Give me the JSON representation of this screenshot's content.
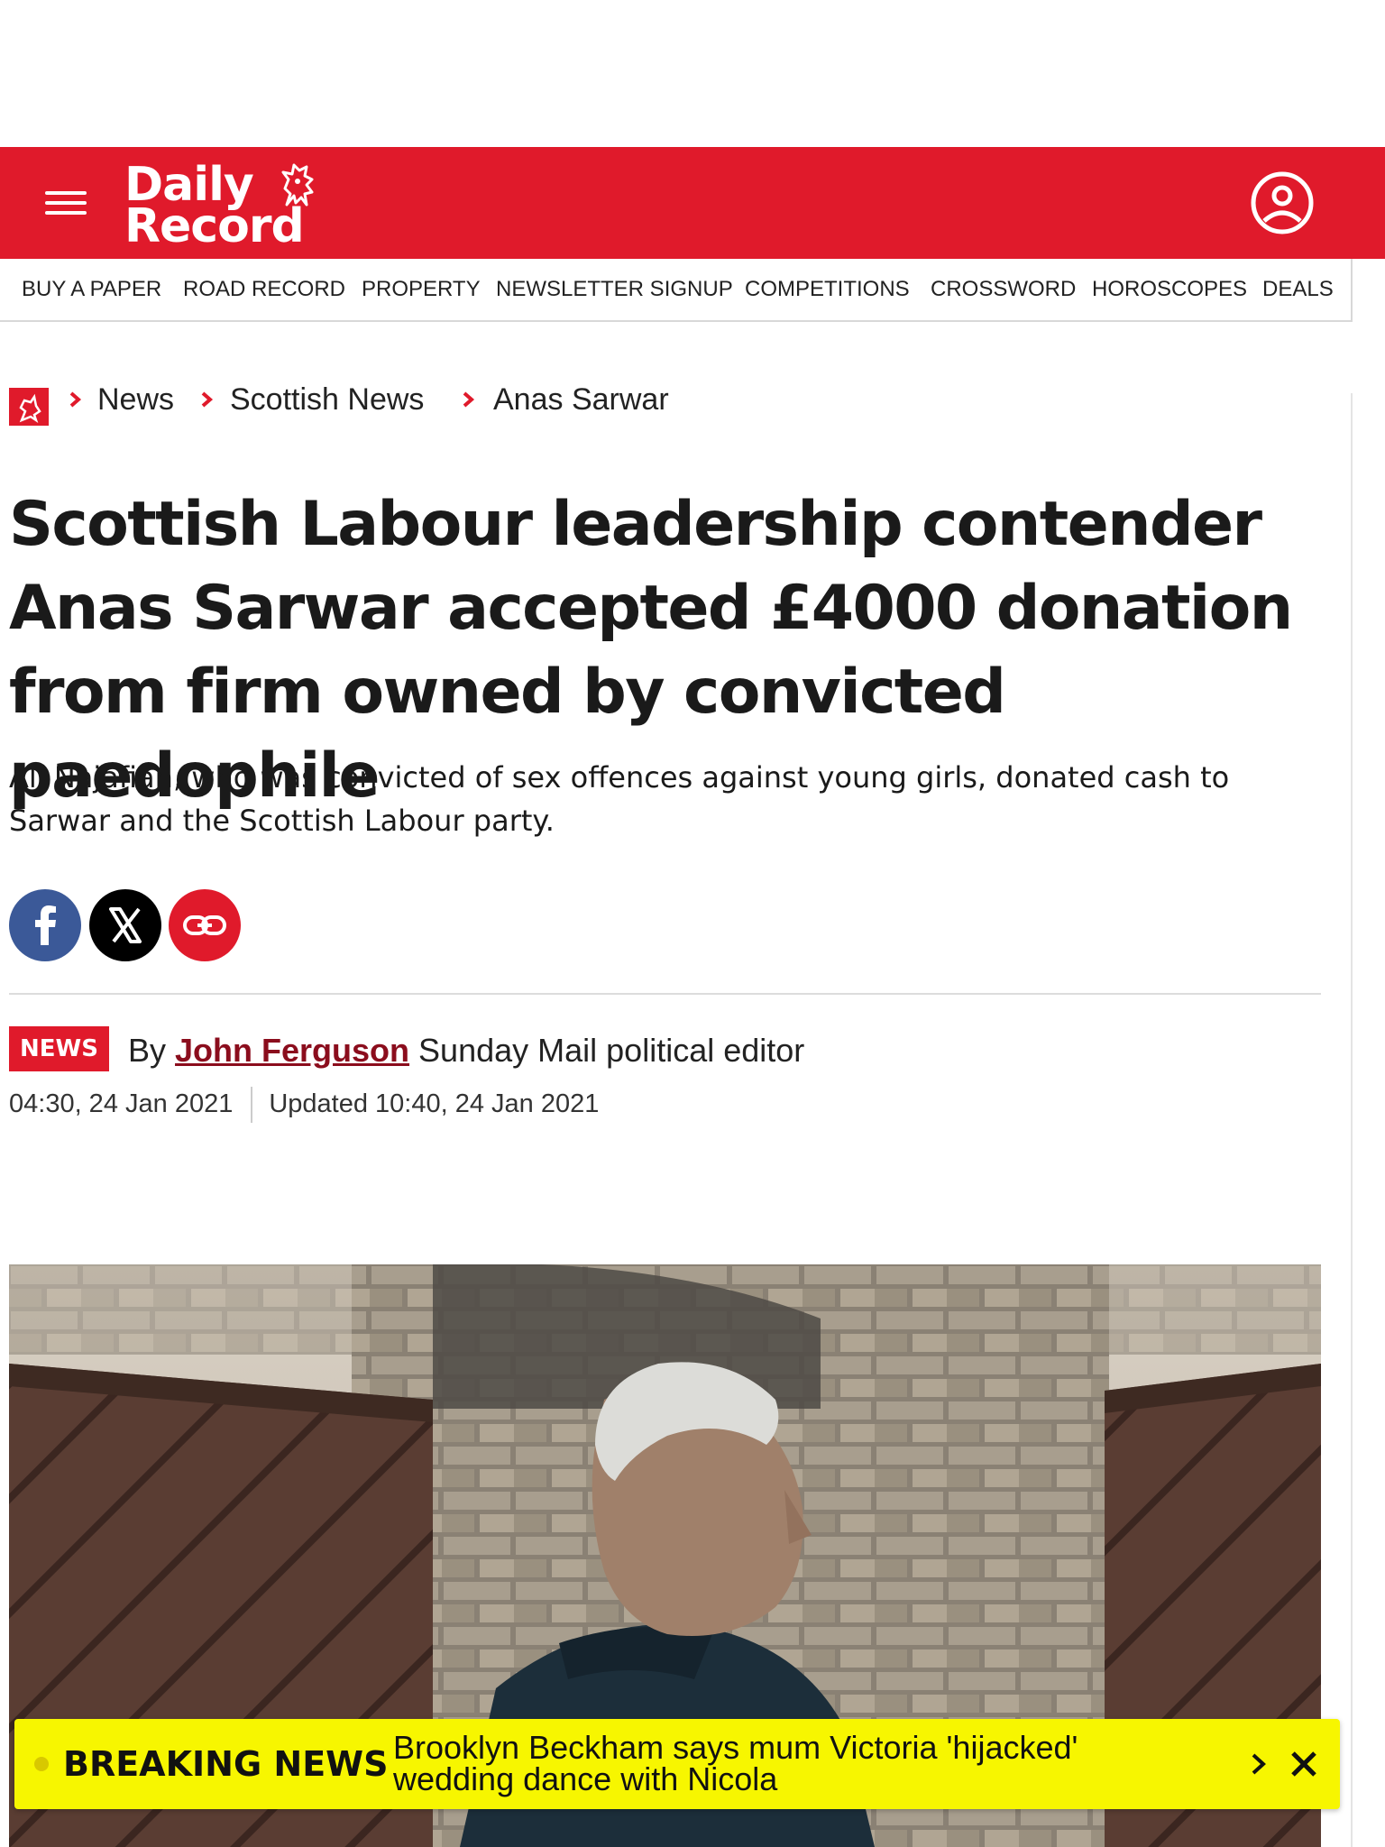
{
  "header": {
    "logo_line1": "Daily",
    "logo_line2": "Record",
    "brand_color": "#e01a2b",
    "menu_icon": "hamburger-menu-icon",
    "account_icon": "account-user-icon"
  },
  "nav": {
    "items": [
      "BUY A PAPER",
      "ROAD RECORD",
      "PROPERTY",
      "NEWSLETTER SIGNUP",
      "COMPETITIONS",
      "CROSSWORD",
      "HOROSCOPES",
      "DEALS"
    ]
  },
  "breadcrumb": {
    "home_icon": "lion-home-icon",
    "items": [
      "News",
      "Scottish News",
      "Anas Sarwar"
    ]
  },
  "article": {
    "headline": "Scottish Labour leadership contender Anas Sarwar accepted £4000 donation from firm owned by convicted paedophile",
    "standfirst": "Ali Najafian, who was convicted of sex offences against young girls, donated cash to Sarwar and the Scottish Labour party.",
    "section_badge": "NEWS",
    "by_prefix": "By",
    "author": "John Ferguson",
    "author_role": "Sunday Mail political editor",
    "published": "04:30, 24 Jan 2021",
    "updated": "Updated 10:40, 24 Jan 2021"
  },
  "share": {
    "facebook_icon": "facebook-icon",
    "x_icon": "x-twitter-icon",
    "link_icon": "copy-link-icon",
    "facebook_color": "#3b5998",
    "x_color": "#000000",
    "link_color": "#e01a2b"
  },
  "breaking": {
    "label": "BREAKING NEWS",
    "text": "Brooklyn Beckham says mum Victoria 'hijacked' wedding dance with Nicola",
    "background": "#f7f600"
  }
}
